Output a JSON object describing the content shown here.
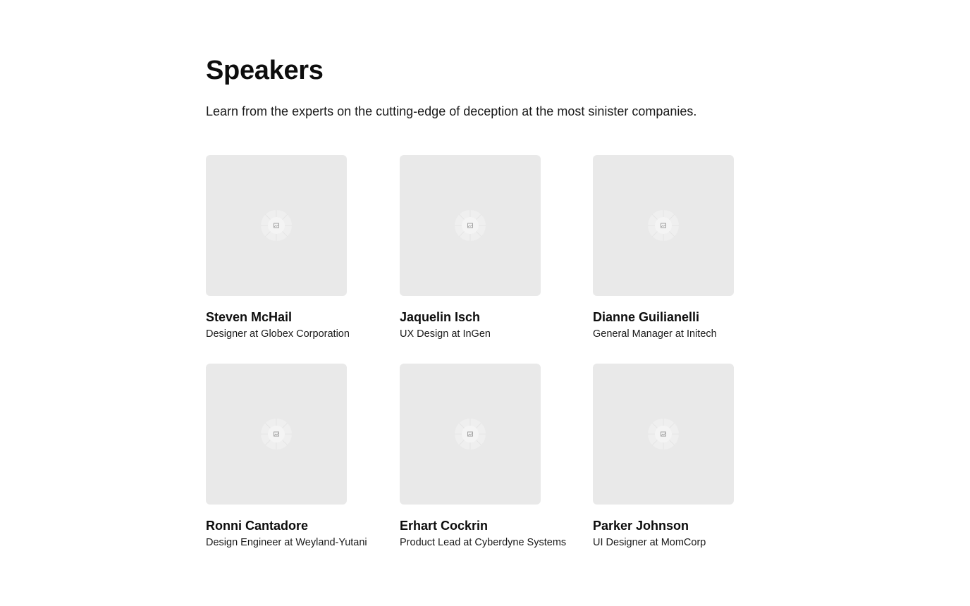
{
  "header": {
    "title": "Speakers",
    "subtitle": "Learn from the experts on the cutting-edge of deception at the most sinister companies."
  },
  "speakers": [
    {
      "name": "Steven McHail",
      "role": "Designer at Globex Corporation",
      "photo_icon": "image-placeholder-icon"
    },
    {
      "name": "Jaquelin Isch",
      "role": "UX Design at InGen",
      "photo_icon": "image-placeholder-icon"
    },
    {
      "name": "Dianne Guilianelli",
      "role": "General Manager at Initech",
      "photo_icon": "image-placeholder-icon"
    },
    {
      "name": "Ronni Cantadore",
      "role": "Design Engineer at Weyland-Yutani",
      "photo_icon": "image-placeholder-icon"
    },
    {
      "name": "Erhart Cockrin",
      "role": "Product Lead at Cyberdyne Systems",
      "photo_icon": "image-placeholder-icon"
    },
    {
      "name": "Parker Johnson",
      "role": "UI Designer at MomCorp",
      "photo_icon": "image-placeholder-icon"
    }
  ],
  "colors": {
    "background": "#ffffff",
    "text": "#0d0d0d",
    "photo_placeholder": "#e9e9e9"
  }
}
